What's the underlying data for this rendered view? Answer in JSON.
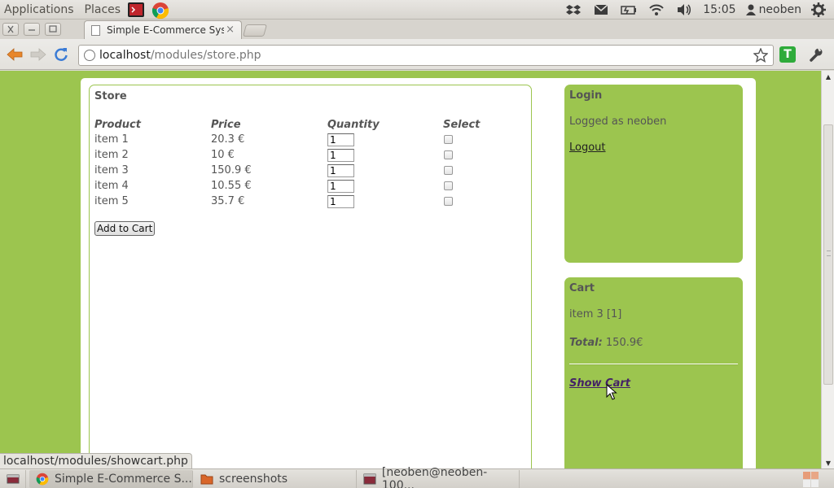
{
  "top_panel": {
    "applications_label": "Applications",
    "places_label": "Places",
    "clock": "15:05",
    "username": "neoben"
  },
  "browser": {
    "tab_title": "Simple E-Commerce System",
    "tab_close": "×",
    "url_host": "localhost",
    "url_path": "/modules/store.php",
    "extension_label": "T",
    "status_url": "localhost/modules/showcart.php"
  },
  "store": {
    "title": "Store",
    "headers": [
      "Product",
      "Price",
      "Quantity",
      "Select"
    ],
    "products": [
      {
        "name": "item 1",
        "price": "20.3 €",
        "qty": "1"
      },
      {
        "name": "item 2",
        "price": "10 €",
        "qty": "1"
      },
      {
        "name": "item 3",
        "price": "150.9 €",
        "qty": "1"
      },
      {
        "name": "item 4",
        "price": "10.55 €",
        "qty": "1"
      },
      {
        "name": "item 5",
        "price": "35.7 €",
        "qty": "1"
      }
    ],
    "add_button": "Add to Cart"
  },
  "login": {
    "title": "Login",
    "status": "Logged as neoben",
    "logout_link": "Logout"
  },
  "cart": {
    "title": "Cart",
    "items_text": "item 3 [1]",
    "total_label": "Total:",
    "total_value": "150.9€",
    "show_cart_link": "Show Cart"
  },
  "taskbar": {
    "tasks": [
      "Simple E-Commerce S...",
      "screenshots",
      "[neoben@neoben-100..."
    ]
  },
  "colors": {
    "page_background": "#9cc54f",
    "text": "#555555"
  }
}
